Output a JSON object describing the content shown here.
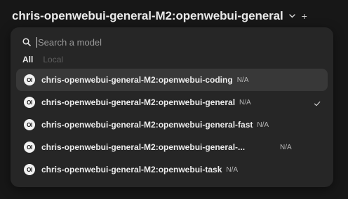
{
  "header": {
    "title": "chris-openwebui-general-M2:openwebui-general",
    "chevron_icon": "chevron-down-icon",
    "plus_label": "+"
  },
  "search": {
    "placeholder": "Search a model",
    "icon": "search-icon"
  },
  "tabs": [
    {
      "label": "All",
      "active": true
    },
    {
      "label": "Local",
      "active": false
    }
  ],
  "models": [
    {
      "logo": "OI",
      "name": "chris-openwebui-general-M2:openwebui-coding",
      "badge": "N/A",
      "highlighted": true,
      "checked": false
    },
    {
      "logo": "OI",
      "name": "chris-openwebui-general-M2:openwebui-general",
      "badge": "N/A",
      "highlighted": false,
      "checked": true
    },
    {
      "logo": "OI",
      "name": "chris-openwebui-general-M2:openwebui-general-fast",
      "badge": "N/A",
      "highlighted": false,
      "checked": false
    },
    {
      "logo": "OI",
      "name": "chris-openwebui-general-M2:openwebui-general-...",
      "badge": "N/A",
      "highlighted": false,
      "checked": false
    },
    {
      "logo": "OI",
      "name": "chris-openwebui-general-M2:openwebui-task",
      "badge": "N/A",
      "highlighted": false,
      "checked": false
    }
  ],
  "colors": {
    "background": "#171717",
    "dropdown": "#262626",
    "highlight": "#383838",
    "text": "#ececec",
    "muted": "#5f5f5f"
  }
}
